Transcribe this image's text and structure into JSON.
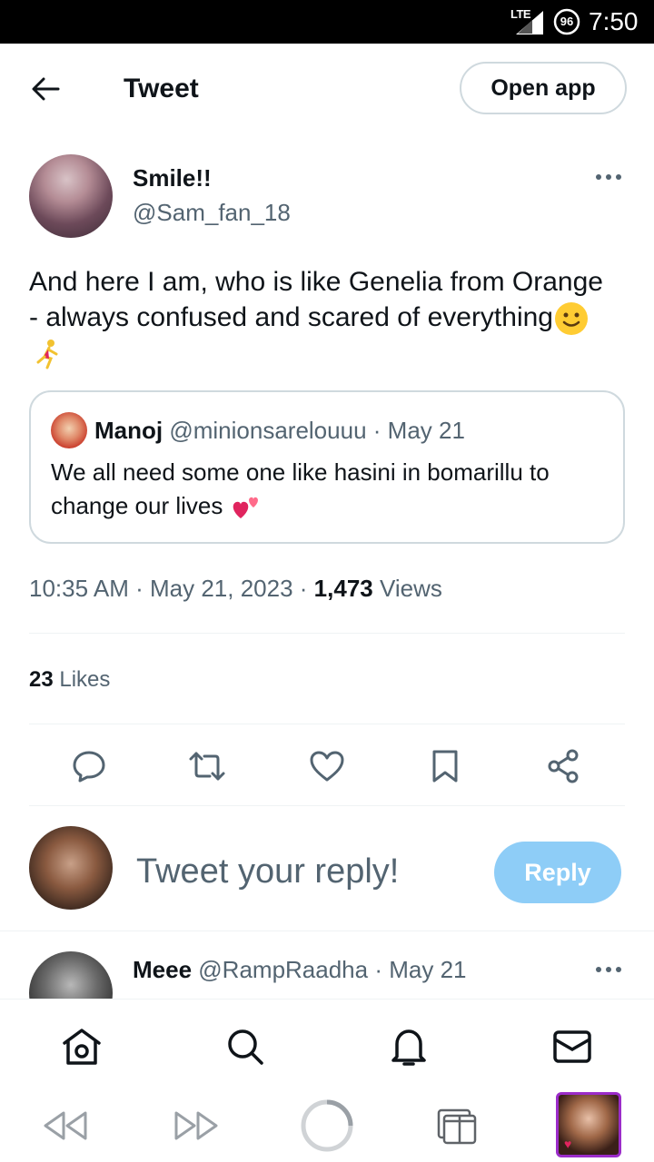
{
  "status_bar": {
    "network": "LTE",
    "battery": "96",
    "time": "7:50"
  },
  "header": {
    "title": "Tweet",
    "open_app_label": "Open app"
  },
  "tweet": {
    "author_name": "Smile!!",
    "author_handle": "@Sam_fan_18",
    "text": "And here I am, who is like Genelia from Orange - always confused and scared of everything",
    "quote": {
      "name": "Manoj",
      "handle": "@minionsarelouuu",
      "date": "May 21",
      "text": "We all need some one like hasini in bomarillu to change our lives"
    },
    "time": "10:35 AM",
    "date": "May 21, 2023",
    "views_count": "1,473",
    "views_label": "Views",
    "likes_count": "23",
    "likes_label": "Likes"
  },
  "reply_composer": {
    "placeholder": "Tweet your reply!",
    "button_label": "Reply"
  },
  "next_tweet": {
    "name": "Meee",
    "handle": "@RampRaadha",
    "date": "May 21"
  },
  "colors": {
    "text_primary": "#0f1419",
    "text_secondary": "#536471",
    "border": "#cfd9de",
    "reply_button": "#8ecdf7",
    "tab_thumb_border": "#9b2cc9"
  },
  "icons": {
    "actions": [
      "reply-icon",
      "retweet-icon",
      "like-icon",
      "bookmark-icon",
      "share-icon"
    ],
    "nav": [
      "home-icon",
      "search-icon",
      "notifications-icon",
      "messages-icon"
    ],
    "browser": [
      "back-icon",
      "forward-icon",
      "reload-icon",
      "tabs-icon"
    ]
  }
}
